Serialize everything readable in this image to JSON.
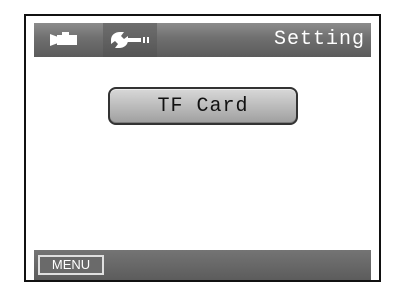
{
  "header": {
    "title": "Setting",
    "tabs": [
      {
        "icon": "video-camera-icon",
        "active": false
      },
      {
        "icon": "wrench-icon",
        "active": true
      }
    ]
  },
  "main": {
    "options": [
      {
        "label": "TF Card"
      }
    ]
  },
  "footer": {
    "menu_label": "MENU"
  },
  "colors": {
    "bar": "#6f6f6f",
    "button": "#b9b9b9",
    "text_light": "#ffffff",
    "text_dark": "#111111"
  }
}
